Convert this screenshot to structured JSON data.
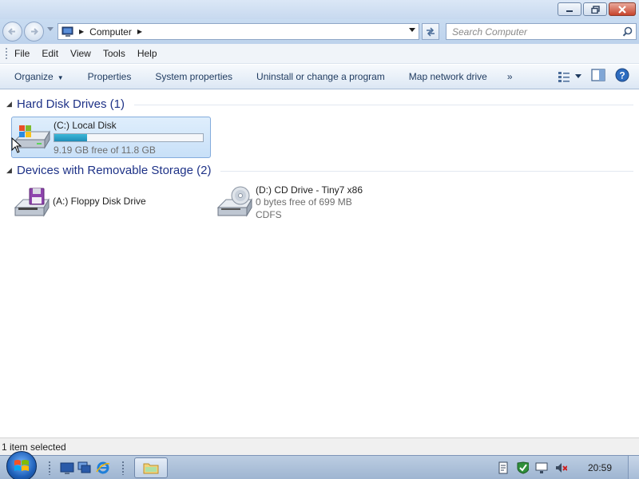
{
  "address": {
    "crumbs": [
      "Computer"
    ],
    "search_placeholder": "Search Computer"
  },
  "menu": [
    "File",
    "Edit",
    "View",
    "Tools",
    "Help"
  ],
  "commands": {
    "organize": "Organize",
    "properties": "Properties",
    "system_properties": "System properties",
    "uninstall": "Uninstall or change a program",
    "map_drive": "Map network drive",
    "more": "»"
  },
  "groups": [
    {
      "title": "Hard Disk Drives (1)",
      "items": [
        {
          "name": "(C:) Local Disk",
          "free_text": "9.19 GB free of 11.8 GB",
          "used_fraction": 0.22,
          "selected": true,
          "icon": "hard-disk-icon"
        }
      ]
    },
    {
      "title": "Devices with Removable Storage (2)",
      "items": [
        {
          "name": "(A:) Floppy Disk Drive",
          "icon": "floppy-drive-icon"
        },
        {
          "name": "(D:) CD Drive - Tiny7 x86",
          "line2": "0 bytes free of 699 MB",
          "line3": "CDFS",
          "icon": "cd-drive-icon"
        }
      ]
    }
  ],
  "status": {
    "text": "1 item selected"
  },
  "taskbar": {
    "clock": "20:59"
  },
  "colors": {
    "group_title": "#1e3287",
    "selection": "#c8e0f8",
    "capacity_fill": "#2ba2c9"
  }
}
